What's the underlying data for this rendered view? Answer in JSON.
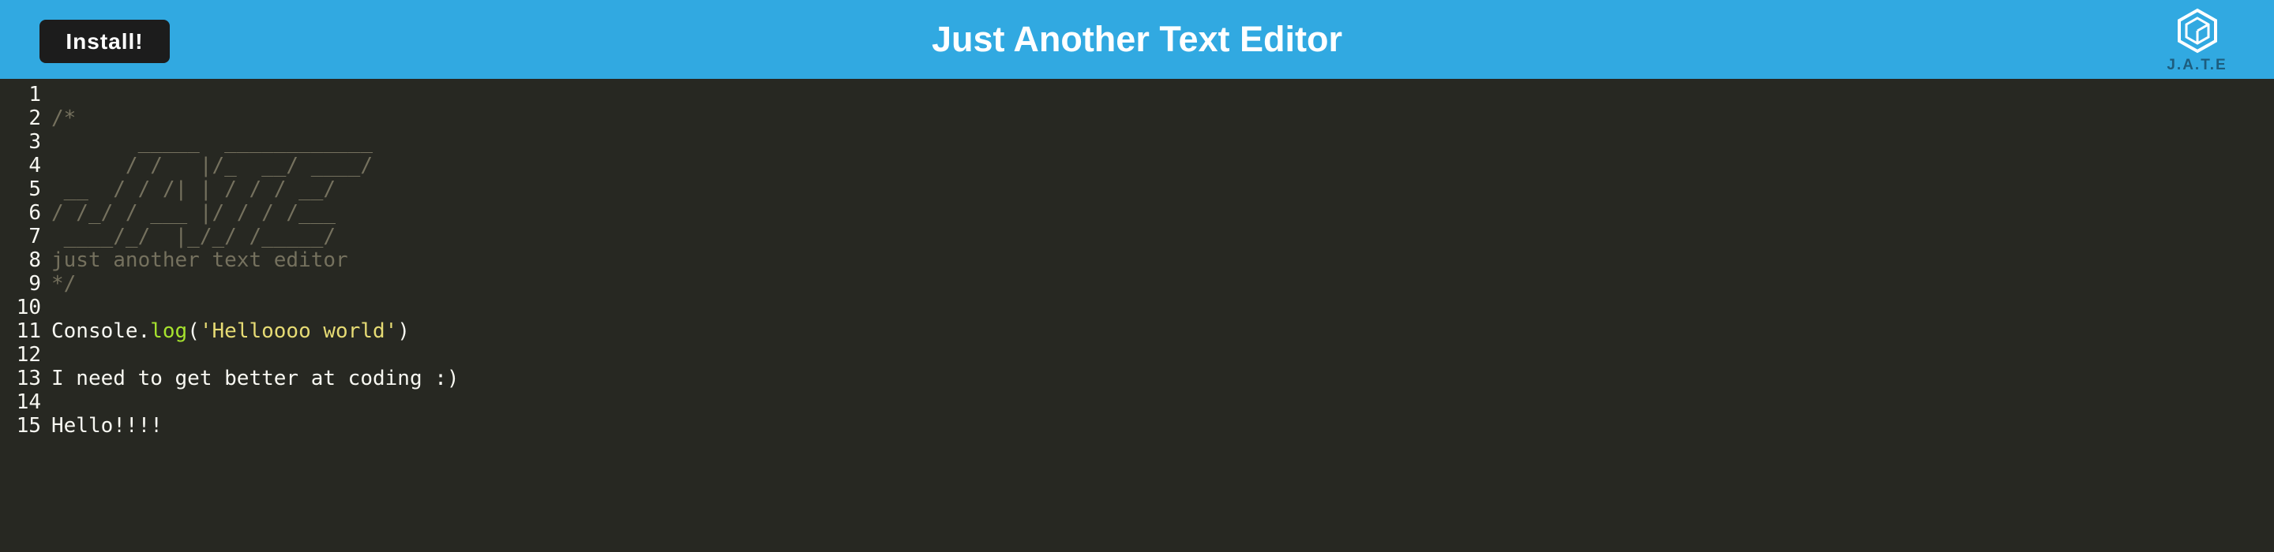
{
  "header": {
    "install_label": "Install!",
    "title": "Just Another Text Editor",
    "logo_text": "J.A.T.E"
  },
  "editor": {
    "lines": [
      {
        "number": "1",
        "text": ""
      },
      {
        "number": "2",
        "text": "/*"
      },
      {
        "number": "3",
        "text": "       _____  ____________"
      },
      {
        "number": "4",
        "text": "      / /   |/_  __/ ____/"
      },
      {
        "number": "5",
        "text": " __  / / /| | / / / __/"
      },
      {
        "number": "6",
        "text": "/ /_/ / ___ |/ / / /___"
      },
      {
        "number": "7",
        "text": " ____/_/  |_/_/ /_____/"
      },
      {
        "number": "8",
        "text": "just another text editor"
      },
      {
        "number": "9",
        "text": "*/"
      },
      {
        "number": "10",
        "text": ""
      },
      {
        "number": "11",
        "tokens": [
          "Console.",
          "log",
          "(",
          "'Helloooo world'",
          ")"
        ]
      },
      {
        "number": "12",
        "text": ""
      },
      {
        "number": "13",
        "text": "I need to get better at coding :)"
      },
      {
        "number": "14",
        "text": ""
      },
      {
        "number": "15",
        "text": "Hello!!!!"
      }
    ]
  },
  "colors": {
    "header_bg": "#31a9e1",
    "editor_bg": "#272822",
    "comment": "#75715e",
    "function": "#a6e22e",
    "string": "#e6db74",
    "text": "#f8f8f2"
  },
  "icons": {
    "logo": "cube-logo-icon"
  }
}
